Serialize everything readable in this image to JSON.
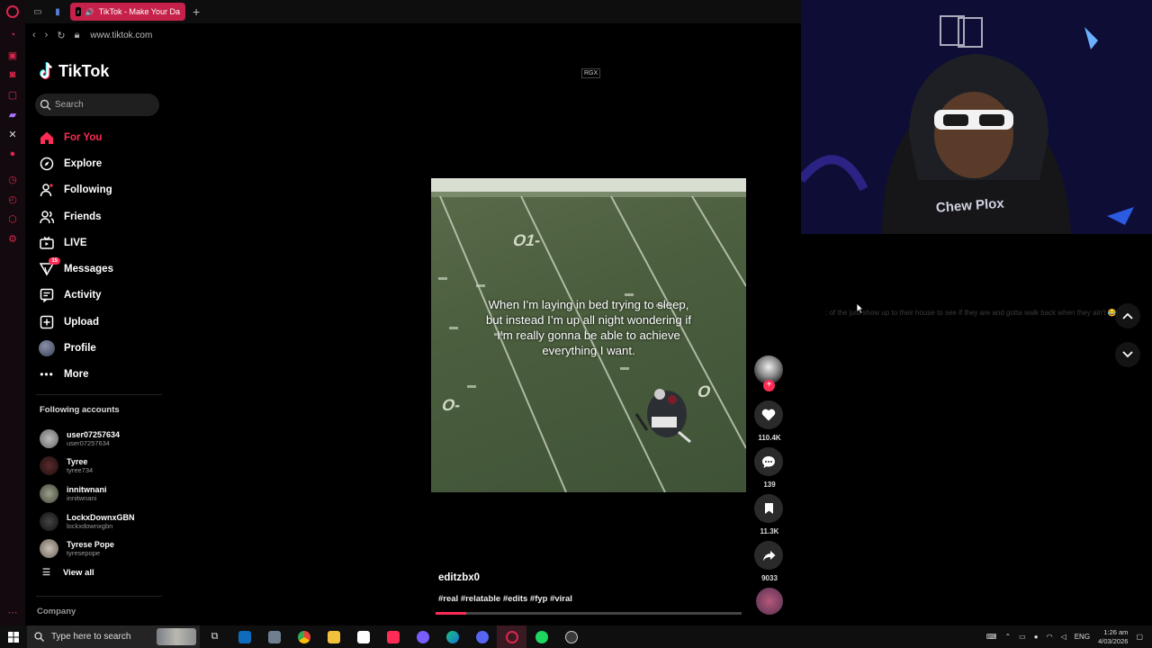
{
  "browser": {
    "tab_title": "TikTok - Make Your Da",
    "url": "www.tiktok.com"
  },
  "tiktok": {
    "brand": "TikTok",
    "search_placeholder": "Search",
    "nav": [
      {
        "label": "For You",
        "icon": "home-icon",
        "active": true
      },
      {
        "label": "Explore",
        "icon": "compass-icon"
      },
      {
        "label": "Following",
        "icon": "following-icon"
      },
      {
        "label": "Friends",
        "icon": "friends-icon"
      },
      {
        "label": "LIVE",
        "icon": "live-icon"
      },
      {
        "label": "Messages",
        "icon": "messages-icon",
        "badge": "15"
      },
      {
        "label": "Activity",
        "icon": "activity-icon"
      },
      {
        "label": "Upload",
        "icon": "upload-icon"
      },
      {
        "label": "Profile",
        "icon": "profile-icon"
      },
      {
        "label": "More",
        "icon": "more-icon"
      }
    ],
    "following_header": "Following accounts",
    "following": [
      {
        "name": "user07257634",
        "handle": "user07257634"
      },
      {
        "name": "Tyree",
        "handle": "tyree734"
      },
      {
        "name": "innitwnani",
        "handle": "innitwnani"
      },
      {
        "name": "LockxDownxGBN",
        "handle": "lockxdownxgbn"
      },
      {
        "name": "Tyrese Pope",
        "handle": "tyresepope"
      }
    ],
    "view_all": "View all",
    "company": "Company"
  },
  "video": {
    "watermark": "RGX",
    "caption": "When I’m laying in bed trying to sleep, but instead I’m up all night wondering if I’m really gonna be able to achieve everything I want.",
    "author": "editzbx0",
    "tags": "#real #relatable #edits #fyp #viral",
    "progress": 0.1,
    "likes": "110.4K",
    "comments": "139",
    "saves": "11.3K",
    "shares": "9033",
    "field_yard_labels": [
      "O1-",
      "O-",
      "O"
    ]
  },
  "comment_panel": {
    "text": ": of the just show up to their house to see if they are and gotta walk back when they ain't 😂"
  },
  "overlay": {
    "hoodie_text": "Chew Plox"
  },
  "taskbar": {
    "search_placeholder": "Type here to search",
    "language": "ENG",
    "time": "1:26 am",
    "date": "4/03/2026"
  },
  "colors": {
    "accent": "#fe2c55",
    "opera": "#d9264b",
    "tab": "#c5214a"
  }
}
